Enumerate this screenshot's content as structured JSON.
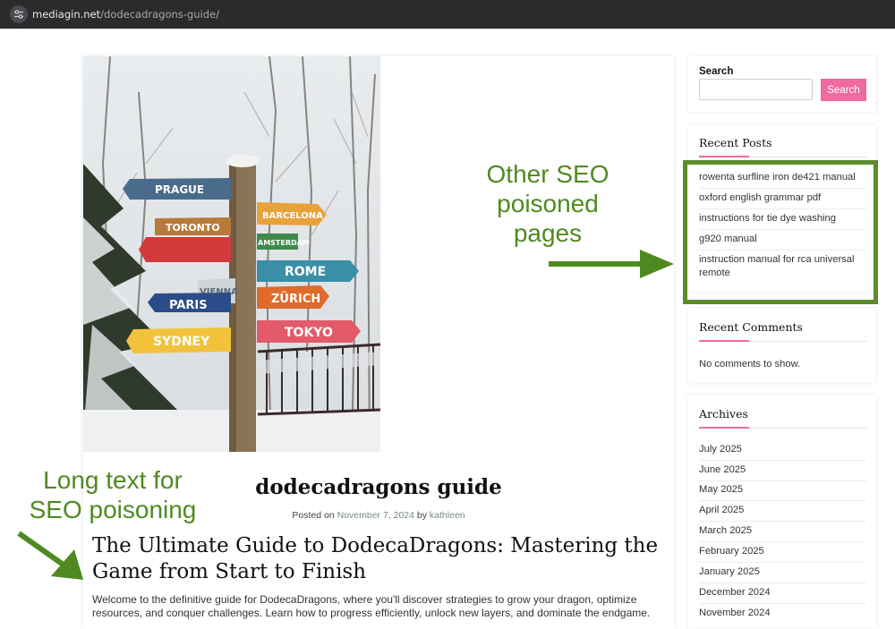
{
  "browser": {
    "url_host": "mediagin.net",
    "url_path": "/dodecadragons-guide/"
  },
  "photo": {
    "signs": [
      "PRAGUE",
      "TORONTO",
      "BARCELONA",
      "AMSTERDAM",
      "ROME",
      "VIENNA",
      "PARIS",
      "ZÜRICH",
      "SYDNEY",
      "TOKYO"
    ]
  },
  "post": {
    "title": "dodecadragons guide",
    "posted_on_label": "Posted on",
    "date": "November 7, 2024",
    "by_label": "by",
    "author": "kathleen",
    "heading": "The Ultimate Guide to DodecaDragons: Mastering the Game from Start to Finish",
    "intro": "Welcome to the definitive guide for DodecaDragons, where you'll discover strategies to grow your dragon, optimize resources, and conquer challenges. Learn how to progress efficiently, unlock new layers, and dominate the endgame."
  },
  "sidebar": {
    "search": {
      "label": "Search",
      "placeholder": "",
      "button_label": "Search"
    },
    "recent_posts": {
      "title": "Recent Posts",
      "items": [
        "rowenta surfline iron de421 manual",
        "oxford english grammar pdf",
        "instructions for tie dye washing",
        "g920 manual",
        "instruction manual for rca universal remote"
      ]
    },
    "recent_comments": {
      "title": "Recent Comments",
      "empty_text": "No comments to show."
    },
    "archives": {
      "title": "Archives",
      "items": [
        "July 2025",
        "June 2025",
        "May 2025",
        "April 2025",
        "March 2025",
        "February 2025",
        "January 2025",
        "December 2024",
        "November 2024"
      ]
    }
  },
  "annotations": {
    "seo_pages_line1": "Other SEO",
    "seo_pages_line2": "poisoned",
    "seo_pages_line3": "pages",
    "long_text_line1": "Long text for",
    "long_text_line2": "SEO poisoning",
    "color": "#4f8a21"
  },
  "colors": {
    "accent": "#f06aa0",
    "annotation_box": "#5b8c2a",
    "browser_bar": "#2b2b2e"
  }
}
